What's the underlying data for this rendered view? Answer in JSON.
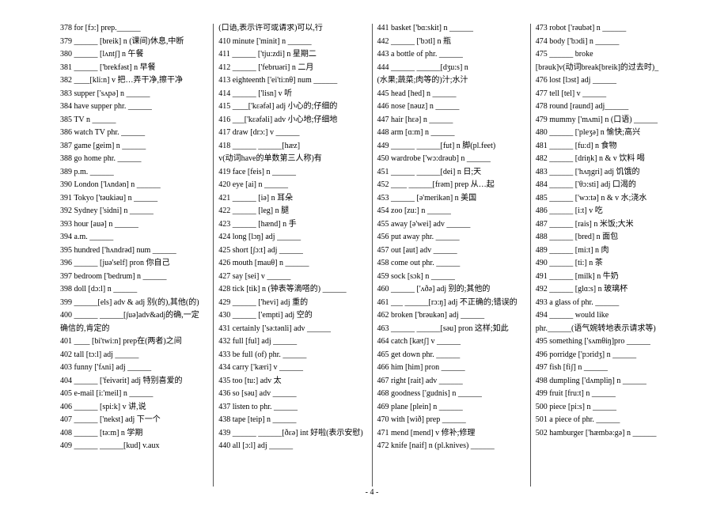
{
  "page_number": "- 4 -",
  "columns": [
    [
      {
        "n": "378",
        "t": "for  [fɔ:] prep.______"
      },
      {
        "n": "379",
        "t": "______ [breik] n (课间)休息,中断"
      },
      {
        "n": "380",
        "t": "______ [lʌntʃ] n 午餐"
      },
      {
        "n": "381",
        "t": "______ ['brekfəst] n 早餐"
      },
      {
        "n": "382",
        "t": "____[kli:n] v 把…弄干净,擦干净"
      },
      {
        "n": "383",
        "t": "supper ['sʌpə] n ______"
      },
      {
        "n": "384",
        "t": "have supper  phr. ______"
      },
      {
        "n": "385",
        "t": "TV  n ______"
      },
      {
        "n": "386",
        "t": "watch TV  phr. ______"
      },
      {
        "n": "387",
        "t": "game [geim] n ______"
      },
      {
        "n": "388",
        "t": "go home  phr. ______"
      },
      {
        "n": "389",
        "t": "p.m. ______"
      },
      {
        "n": "390",
        "t": "London ['lʌndən] n ______"
      },
      {
        "n": "391",
        "t": "Tokyo ['təukiəu] n ______"
      },
      {
        "n": "392",
        "t": "Sydney ['sidni] n ______"
      },
      {
        "n": "393",
        "t": "hour [auə] n ______"
      },
      {
        "n": "394",
        "t": "a.m. ______"
      },
      {
        "n": "395",
        "t": "hundred ['hʌndrəd] num ______"
      },
      {
        "n": "396",
        "t": "______ [juə'self] pron 你自己"
      },
      {
        "n": "397",
        "t": "bedroom ['bedrum] n ______"
      },
      {
        "n": "398",
        "t": "doll [dɔ:l] n ______"
      },
      {
        "n": "399",
        "t": "______[els] adv & adj 别(的),其他(的)"
      },
      {
        "n": "400",
        "t": "______ ______[∫uə]adv&adj的确,一定"
      },
      {
        "n": "",
        "t": "确信的,肯定的"
      },
      {
        "n": "401",
        "t": "____ [bi'twi:n] prep在(两者)之间"
      },
      {
        "n": "402",
        "t": "tall [tɔ:l] adj ______"
      },
      {
        "n": "403",
        "t": "funny ['fʌni] adj ______"
      },
      {
        "n": "404",
        "t": "______ ['feivərit] adj 特别喜爱的"
      },
      {
        "n": "405",
        "t": "e-mail [i:'meil] n ______"
      },
      {
        "n": "406",
        "t": "______ [spi:k] v 讲,说"
      },
      {
        "n": "407",
        "t": "______ ['nekst] adj 下一个"
      },
      {
        "n": "408",
        "t": "______ [tə:m] n 学期"
      },
      {
        "n": "409",
        "t": "______          ______[kud]     v.aux"
      }
    ],
    [
      {
        "n": "",
        "t": "(口语,表示许可或请求)可以,行"
      },
      {
        "n": "410",
        "t": "minute ['minit] n ______"
      },
      {
        "n": "411",
        "t": "______ ['tju:zdi] n 星期二"
      },
      {
        "n": "412",
        "t": "______ ['februəri] n 二月"
      },
      {
        "n": "413",
        "t": "eighteenth ['ei'ti:nθ] num ______"
      },
      {
        "n": "414",
        "t": "______ ['lisn] v 听"
      },
      {
        "n": "415",
        "t": "____['kɛəfəl] adj 小心的;仔细的"
      },
      {
        "n": "416",
        "t": "___['kɛəfəli] adv 小心地;仔细地"
      },
      {
        "n": "417",
        "t": "draw [drɔ:] v ______"
      },
      {
        "n": "418",
        "t": "______                   ______[hæz]"
      },
      {
        "n": "",
        "t": "v(动词have的单数第三人称)有"
      },
      {
        "n": "419",
        "t": "face [feis] n ______"
      },
      {
        "n": "420",
        "t": "eye [ai] n ______"
      },
      {
        "n": "421",
        "t": "______ [iə] n 耳朵"
      },
      {
        "n": "422",
        "t": "______ [leg] n 腿"
      },
      {
        "n": "423",
        "t": "______ [hænd] n 手"
      },
      {
        "n": "424",
        "t": "long [lɔŋ] adj ______"
      },
      {
        "n": "425",
        "t": "short [∫ɔ:t] adj ______"
      },
      {
        "n": "426",
        "t": "mouth [mauθ] n ______"
      },
      {
        "n": "427",
        "t": "say [sei] v ______"
      },
      {
        "n": "428",
        "t": "tick [tik] n (钟表等滴嗒的) ______"
      },
      {
        "n": "429",
        "t": "______ ['hevi] adj 重的"
      },
      {
        "n": "430",
        "t": "______ ['empti] adj 空的"
      },
      {
        "n": "431",
        "t": "certainly ['sə:tənli] adv ______"
      },
      {
        "n": "432",
        "t": "full [ful] adj ______"
      },
      {
        "n": "433",
        "t": "be full (of)  phr. ______"
      },
      {
        "n": "434",
        "t": "carry ['kæri] v ______"
      },
      {
        "n": "435",
        "t": "too [tu:] adv 太"
      },
      {
        "n": "436",
        "t": "so [səu] adv ______"
      },
      {
        "n": "437",
        "t": "listen to  phr. ______"
      },
      {
        "n": "438",
        "t": "tape [teip] n ______"
      },
      {
        "n": "439",
        "t": "______ ______[ðɛə] int 好啦(表示安慰)"
      },
      {
        "n": "440",
        "t": "all [ɔ:l] adj ______"
      }
    ],
    [
      {
        "n": "441",
        "t": "basket ['bɑ:skit] n ______"
      },
      {
        "n": "442",
        "t": "______ ['bɔtl] n 瓶"
      },
      {
        "n": "443",
        "t": "a bottle of  phr. ______"
      },
      {
        "n": "444",
        "t": "______           ______[dʒu:s]        n"
      },
      {
        "n": "",
        "t": "(水果;蔬菜;肉等的)汁;水汁"
      },
      {
        "n": "445",
        "t": "head [hed] n ______"
      },
      {
        "n": "446",
        "t": "nose [nəuz] n ______"
      },
      {
        "n": "447",
        "t": "hair [hɛə] n ______"
      },
      {
        "n": "448",
        "t": "arm [ɑ:m] n ______"
      },
      {
        "n": "449",
        "t": "______ ______[fut] n 脚(pl.feet)"
      },
      {
        "n": "450",
        "t": "wardrobe ['wɔ:drəub] n ______"
      },
      {
        "n": "451",
        "t": "______ ______[dei] n 日;天"
      },
      {
        "n": "452",
        "t": "____ ______[frəm] prep 从…起"
      },
      {
        "n": "453",
        "t": "______ [ə'merikən] n 美国"
      },
      {
        "n": "454",
        "t": "zoo [zu:] n ______"
      },
      {
        "n": "455",
        "t": "away [ə'wei] adv ______"
      },
      {
        "n": "456",
        "t": "put away  phr. ______"
      },
      {
        "n": "457",
        "t": "out [aut] adv ______"
      },
      {
        "n": "458",
        "t": "come out  phr. ______"
      },
      {
        "n": "459",
        "t": "sock [sɔk] n ______"
      },
      {
        "n": "460",
        "t": "______ ['ʌðə] adj 别的;其他的"
      },
      {
        "n": "461",
        "t": "___ ______[rɔ:ŋ] adj 不正确的;错误的"
      },
      {
        "n": "462",
        "t": "broken ['brəukən] adj ______"
      },
      {
        "n": "463",
        "t": "______ ______[səu] pron 这样;如此"
      },
      {
        "n": "464",
        "t": "catch [kætʃ] v ______"
      },
      {
        "n": "465",
        "t": "get down  phr. ______"
      },
      {
        "n": "466",
        "t": "him [him] pron ______"
      },
      {
        "n": "467",
        "t": "right [rait] adv ______"
      },
      {
        "n": "468",
        "t": "goodness ['gudnis] n ______"
      },
      {
        "n": "469",
        "t": "plane [plein] n ______"
      },
      {
        "n": "470",
        "t": "with [wið] prep ______"
      },
      {
        "n": "471",
        "t": "mend [mend] v  修补;修理"
      },
      {
        "n": "472",
        "t": "knife [naif] n (pl.knives) ______"
      }
    ],
    [
      {
        "n": "473",
        "t": "robot ['rəubət] n ______"
      },
      {
        "n": "474",
        "t": "body ['bɔdi] n ______"
      },
      {
        "n": "475",
        "t": "______                                broke"
      },
      {
        "n": "",
        "t": "     [brəuk]v(动词break[breik]的过去时)_"
      },
      {
        "n": "476",
        "t": "lost [lɔst] adj ______"
      },
      {
        "n": "477",
        "t": "tell [tel] v ______"
      },
      {
        "n": "478",
        "t": "round [raund] adj______"
      },
      {
        "n": "479",
        "t": "mummy ['mʌmi] n (口语) ______"
      },
      {
        "n": "480",
        "t": "______ ['pleʒə] n 愉快;高兴"
      },
      {
        "n": "481",
        "t": "______ [fu:d] n 食物"
      },
      {
        "n": "482",
        "t": "______ [driŋk] n & v 饮料  喝"
      },
      {
        "n": "483",
        "t": "______ ['hʌŋgri] adj 饥饿的"
      },
      {
        "n": "484",
        "t": "______ ['θɔ:sti] adj 口渴的"
      },
      {
        "n": "485",
        "t": "______ ['wɔ:tə] n & v  水;浇水"
      },
      {
        "n": "486",
        "t": "______ [i:t] v  吃"
      },
      {
        "n": "487",
        "t": "______ [rais] n 米饭;大米"
      },
      {
        "n": "488",
        "t": "______ [bred] n 面包"
      },
      {
        "n": "489",
        "t": "______ [mi:t] n 肉"
      },
      {
        "n": "490",
        "t": "______ [ti:] n 茶"
      },
      {
        "n": "491",
        "t": "______ [milk] n 牛奶"
      },
      {
        "n": "492",
        "t": "______ [glɑ:s] n 玻璃杯"
      },
      {
        "n": "493",
        "t": "a glass of  phr. ______"
      },
      {
        "n": "494",
        "t": "______               would          like"
      },
      {
        "n": "",
        "t": "phr.______(语气婉转地表示请求等)"
      },
      {
        "n": "495",
        "t": "something ['sʌmθiŋ]pro ______"
      },
      {
        "n": "496",
        "t": "porridge ['pɔridʒ] n ______"
      },
      {
        "n": "497",
        "t": "fish [fiʃ] n ______"
      },
      {
        "n": "498",
        "t": "dumpling ['dʌmpliŋ] n ______"
      },
      {
        "n": "499",
        "t": "fruit [fru:t] n ______"
      },
      {
        "n": "500",
        "t": "piece [pi:s] n ______"
      },
      {
        "n": "501",
        "t": "a piece of  phr. ______"
      },
      {
        "n": "502",
        "t": "hamburger ['hæmbə:gə] n ______"
      }
    ]
  ]
}
